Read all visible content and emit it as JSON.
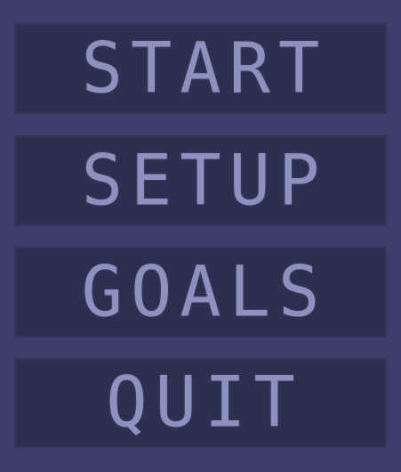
{
  "menu": {
    "items": [
      {
        "label": "START"
      },
      {
        "label": "SETUP"
      },
      {
        "label": "GOALS"
      },
      {
        "label": "QUIT"
      }
    ]
  },
  "colors": {
    "background": "#3c3d69",
    "button": "#2d2f4e",
    "text": "#8e90c0"
  }
}
